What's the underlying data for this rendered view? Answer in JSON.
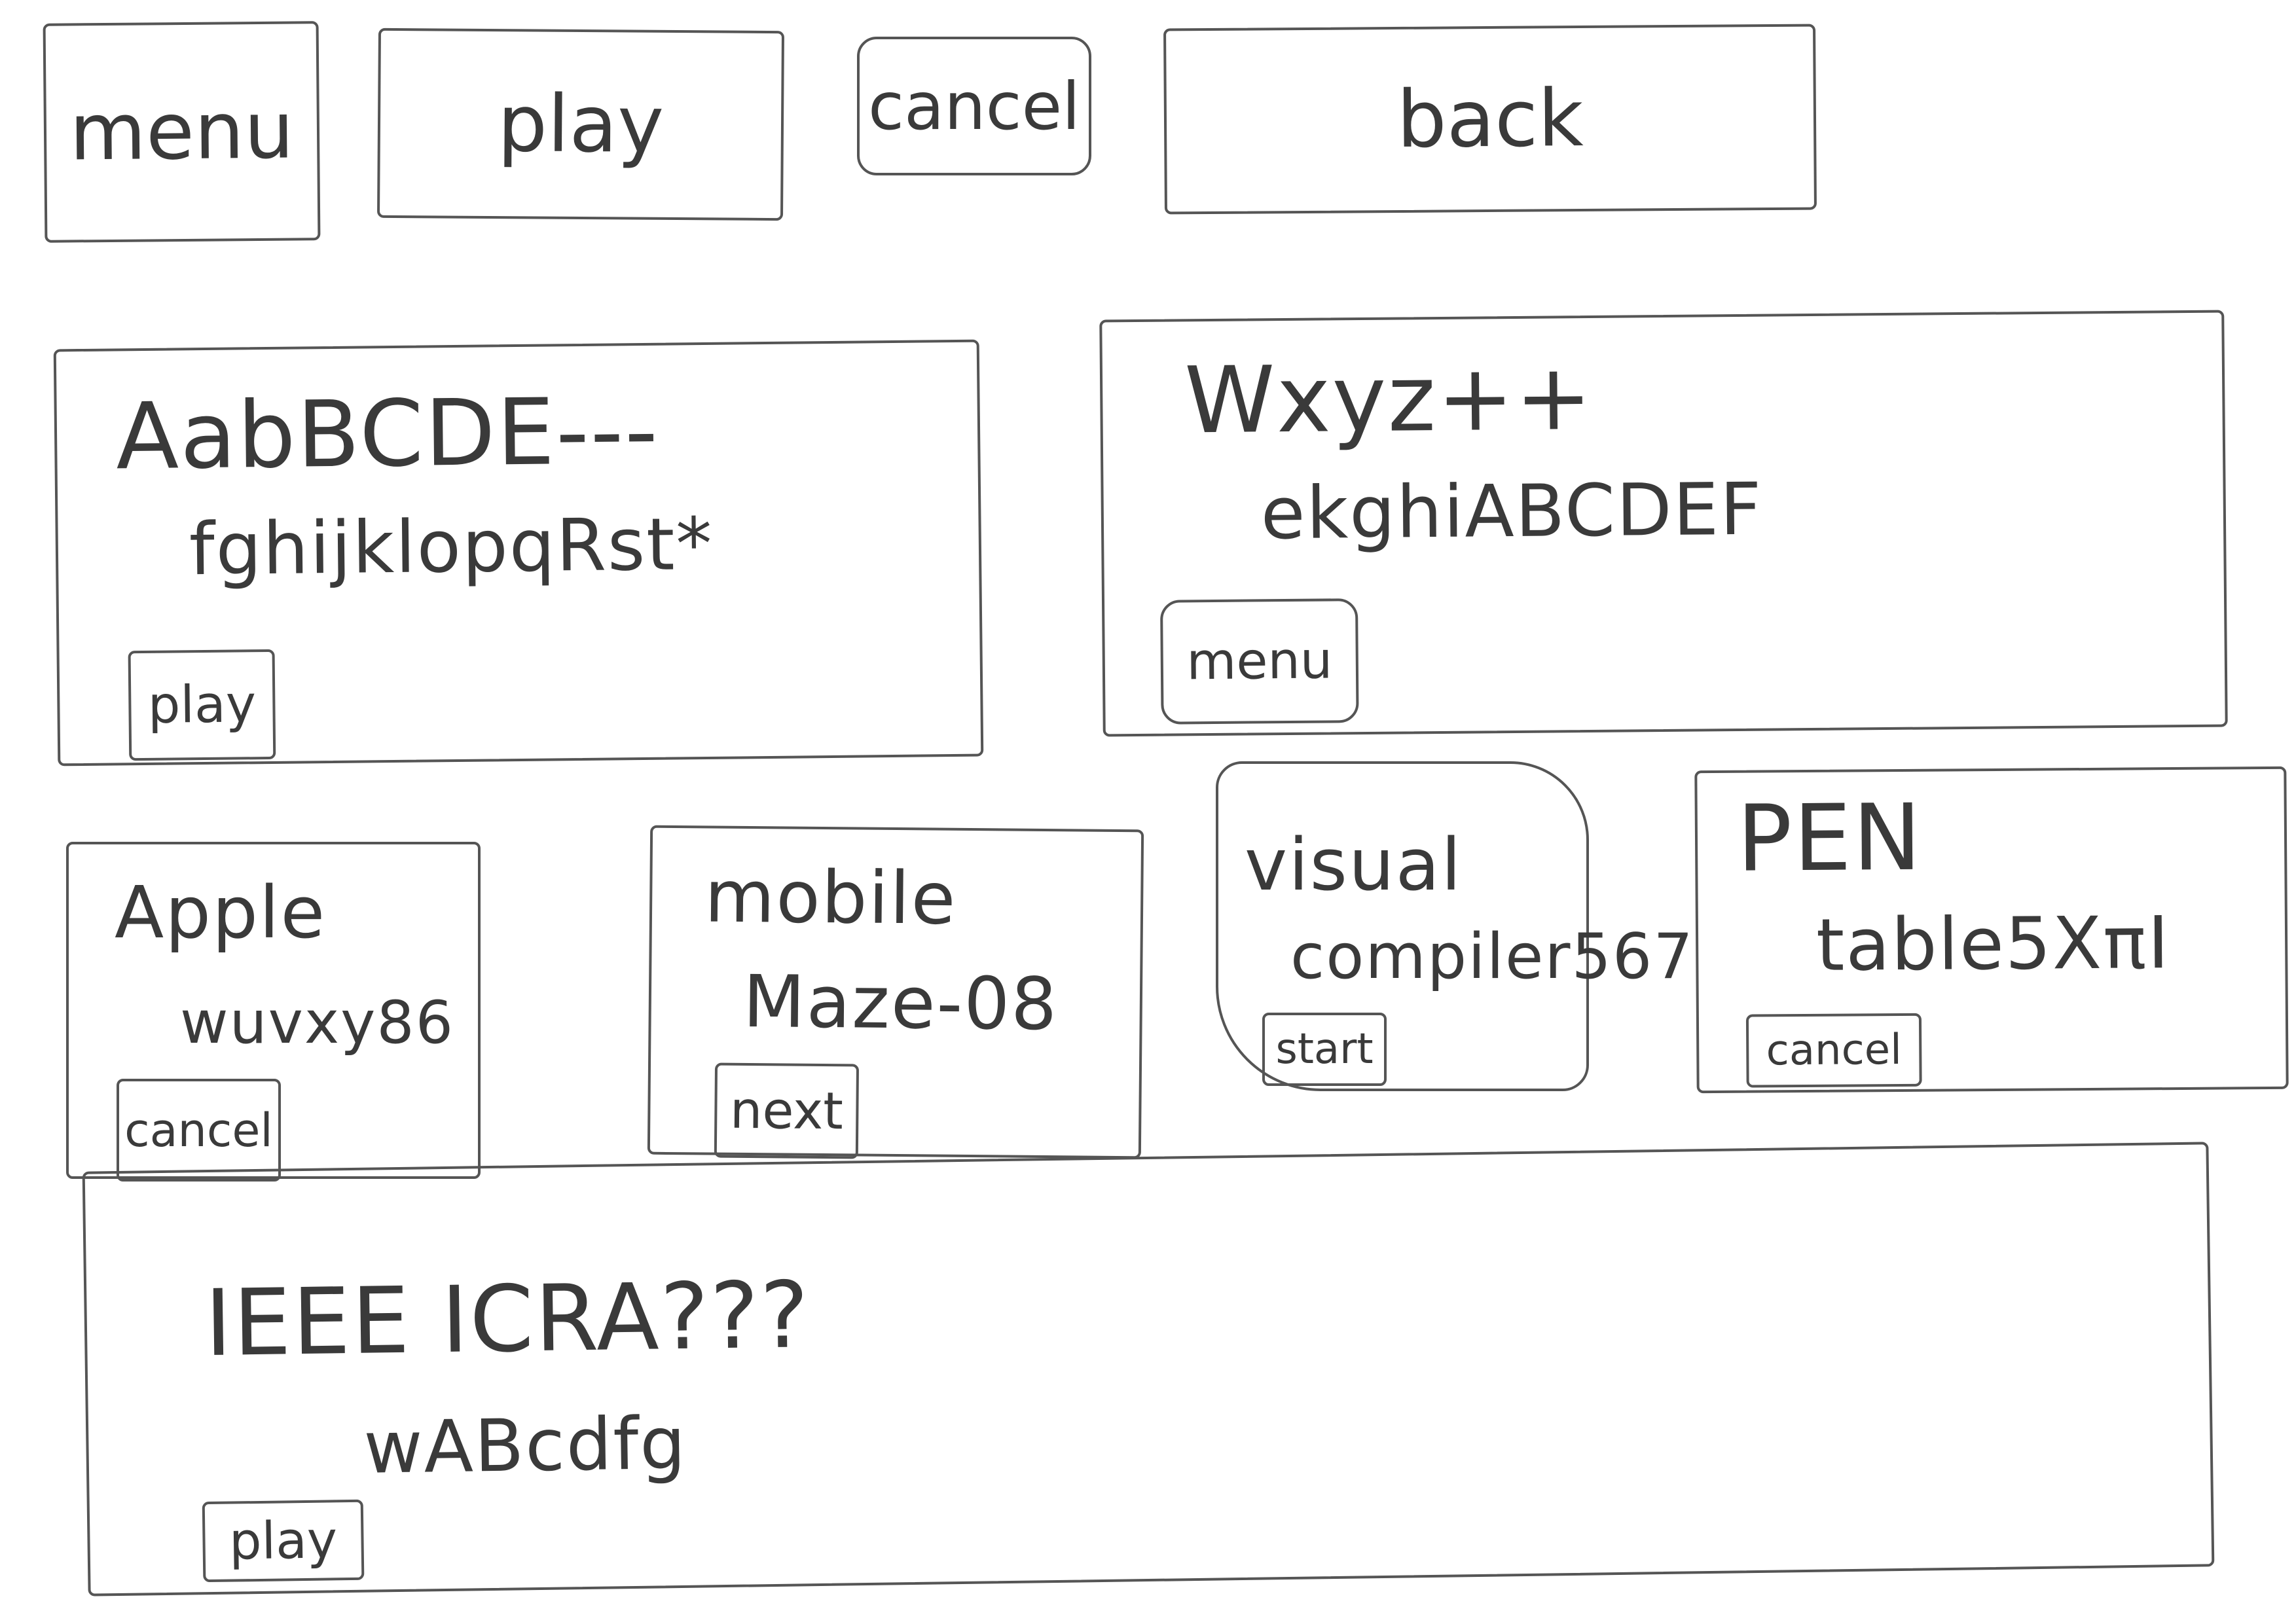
{
  "top_buttons": [
    {
      "label": "menu"
    },
    {
      "label": "play"
    },
    {
      "label": "cancel"
    },
    {
      "label": "back"
    }
  ],
  "cards": [
    {
      "line1": "AabBCDE---",
      "line2": "fghijklopqRst*",
      "button": "play"
    },
    {
      "line1": "Wxyz++",
      "line2": "ekghiABCDEF",
      "button": "menu"
    },
    {
      "line1": "Apple",
      "line2": "wuvxy86",
      "button": "cancel"
    },
    {
      "line1": "mobile",
      "line2": "Maze-08",
      "button": "next"
    },
    {
      "line1": "visual",
      "line2": "compiler567",
      "button": "start"
    },
    {
      "line1": "PEN",
      "line2": "table5XπI",
      "button": "cancel"
    },
    {
      "line1": "IEEE ICRA???",
      "line2": "wABcdfg",
      "button": "play"
    }
  ]
}
